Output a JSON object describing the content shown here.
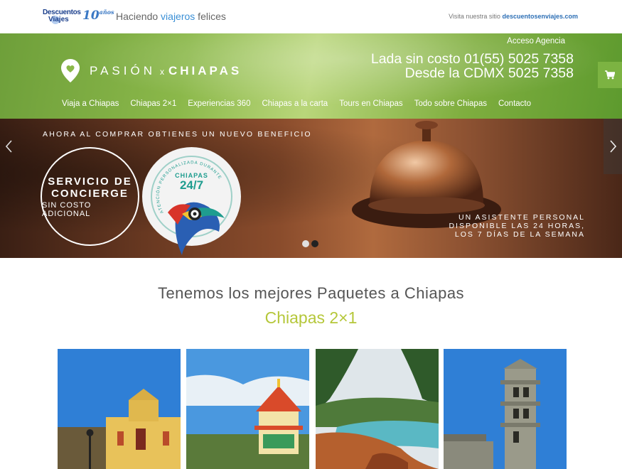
{
  "topbar": {
    "logo_line1": "Descuentos",
    "logo_line2": "Viajes",
    "logo_anniv": "10",
    "logo_anniv_suffix": "años",
    "tagline_pre": "Haciendo ",
    "tagline_hl": "viajeros",
    "tagline_post": " felices",
    "visit_label": "Visita nuestra sitio",
    "visit_link": "descuentosenviajes.com"
  },
  "header": {
    "acceso": "Acceso Agencia",
    "brand_left": "PASIÓN",
    "brand_x": "x",
    "brand_right": "CHIAPAS",
    "phone_line1": "Lada sin costo 01(55) 5025 7358",
    "phone_line2": "Desde la CDMX 5025 7358",
    "cart_icon": "shopping-cart-icon",
    "nav": [
      "Viaja a Chiapas",
      "Chiapas 2×1",
      "Experiencias 360",
      "Chiapas a la carta",
      "Tours en Chiapas",
      "Todo sobre Chiapas",
      "Contacto"
    ]
  },
  "slider": {
    "beneficio": "AHORA AL COMPRAR OBTIENES UN NUEVO BENEFICIO",
    "circle1_line1": "SERVICIO DE",
    "circle1_line2": "CONCIERGE",
    "circle1_line3": "SIN COSTO ADICIONAL",
    "circle2_arc": "ATENCIÓN PERSONALIZADA DURANTE TU VIAJE",
    "circle2_t1": "CHIAPAS",
    "circle2_t2": "24/7",
    "asistente_line1": "UN ASISTENTE PERSONAL",
    "asistente_line2": "DISPONIBLE LAS 24 HORAS,",
    "asistente_line3": "LOS 7 DÍAS DE LA SEMANA",
    "dots": [
      {
        "active": true
      },
      {
        "active": false
      }
    ]
  },
  "content": {
    "heading": "Tenemos los mejores Paquetes a Chiapas",
    "subheading": "Chiapas 2×1"
  },
  "colors": {
    "accent_green": "#7cb342",
    "subheading": "#b5c73a",
    "brand_blue": "#1b3f8c"
  }
}
